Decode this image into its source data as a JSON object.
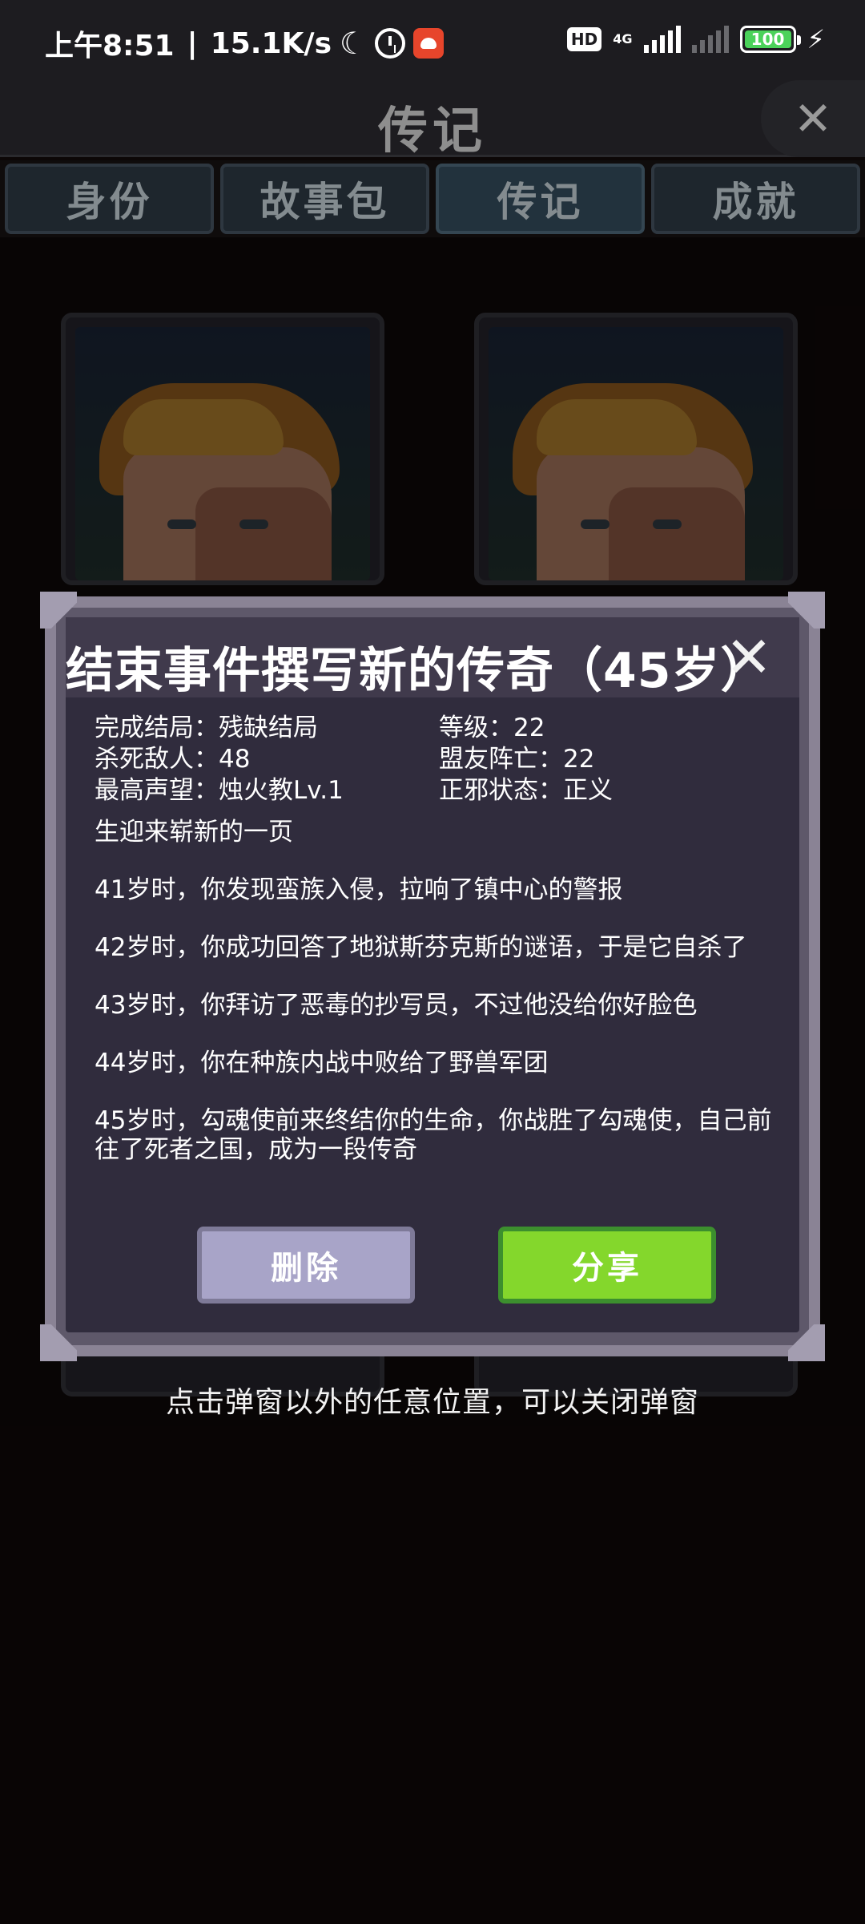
{
  "status_bar": {
    "time": "上午8:51",
    "speed": "15.1K/s",
    "hd": "HD",
    "net_type": "4G",
    "battery": "100"
  },
  "header": {
    "title": "传记",
    "close_icon": "close-icon"
  },
  "tabs": [
    {
      "label": "身份",
      "active": false
    },
    {
      "label": "故事包",
      "active": false
    },
    {
      "label": "传记",
      "active": true
    },
    {
      "label": "成就",
      "active": false
    }
  ],
  "modal": {
    "title": "结束事件撰写新的传奇（45岁）",
    "stats": {
      "ending": "完成结局：残缺结局",
      "level": "等级：22",
      "kills": "杀死敌人：48",
      "allies_lost": "盟友阵亡：22",
      "reputation": "最高声望：烛火教Lv.1",
      "alignment": "正邪状态：正义"
    },
    "bio": [
      "生迎来崭新的一页",
      "41岁时，你发现蛮族入侵，拉响了镇中心的警报",
      "42岁时，你成功回答了地狱斯芬克斯的谜语，于是它自杀了",
      "43岁时，你拜访了恶毒的抄写员，不过他没给你好脸色",
      "44岁时，你在种族内战中败给了野兽军团",
      "45岁时，勾魂使前来终结你的生命，你战胜了勾魂使，自己前往了死者之国，成为一段传奇"
    ],
    "delete_label": "删除",
    "share_label": "分享"
  },
  "hint": "点击弹窗以外的任意位置，可以关闭弹窗",
  "colors": {
    "share_button": "#84d72c",
    "delete_button": "#a8a4c8",
    "modal_body": "#302c3d"
  }
}
